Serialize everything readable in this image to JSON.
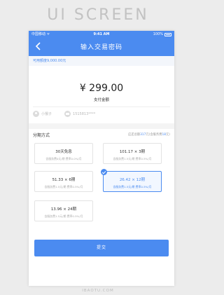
{
  "banner": {
    "text": "UI SCREEN"
  },
  "status_bar": {
    "carrier": "中国移动 ᯤ",
    "time": "9:41 AM",
    "battery": "100%"
  },
  "header": {
    "title": "输入交易密码"
  },
  "limit": {
    "text": "可用额度9,000.00元"
  },
  "payment": {
    "amount": "¥ 299.00",
    "label": "支付金额"
  },
  "account": {
    "user": "小猴子",
    "card": "1515813****"
  },
  "installment": {
    "title": "分期方式",
    "summary_prefix": "应还总额",
    "summary_total": "317",
    "summary_mid": "元(含服务费",
    "summary_fee": "18",
    "summary_suffix": "元)",
    "options": [
      {
        "main": "30天免息",
        "sub": "含服务费0元/期   费率0.0%/月",
        "selected": false
      },
      {
        "main": "101.17 × 3期",
        "sub": "含服务费1.5元/期   费率0.5%/月",
        "selected": false
      },
      {
        "main": "51.33 × 6期",
        "sub": "含服务费1.5元/期   费率0.5%/月",
        "selected": false
      },
      {
        "main": "26.42 × 12期",
        "sub": "含服务费1.5元/期   费率0.5%/月",
        "selected": true
      },
      {
        "main": "13.96 × 24期",
        "sub": "含服务费1.5元/期   费率0.5%/月",
        "selected": false
      }
    ]
  },
  "submit": {
    "label": "提交"
  },
  "footer": {
    "text": "IBAOTU.COM"
  },
  "colors": {
    "primary": "#4b8bf0",
    "background": "#ececec"
  }
}
